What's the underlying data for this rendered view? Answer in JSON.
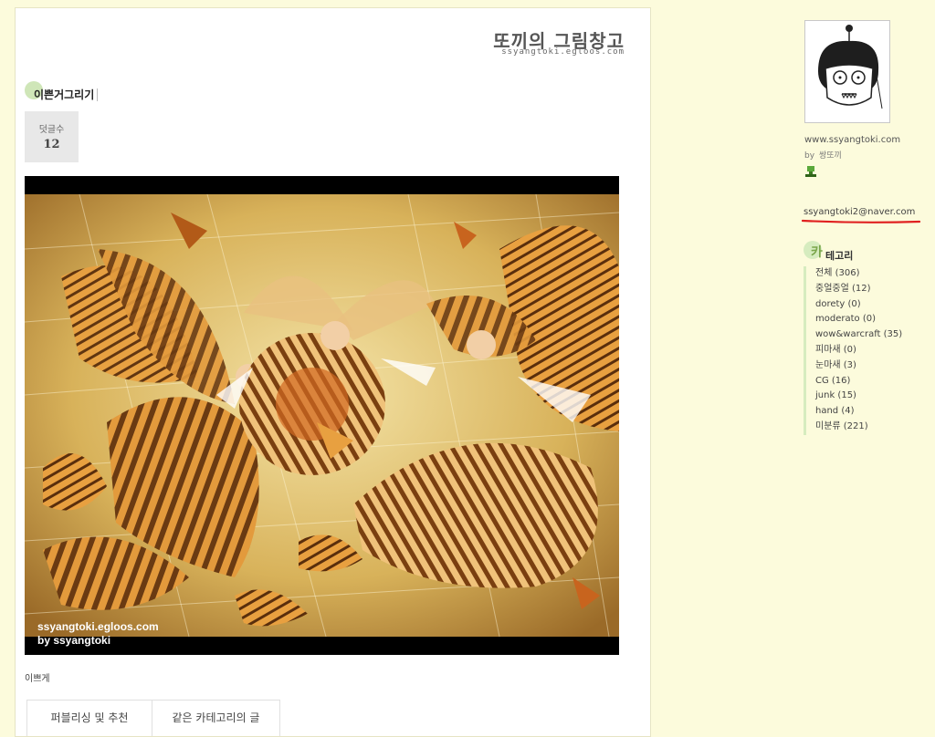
{
  "blog": {
    "title": "또끼의 그림창고",
    "url": "ssyangtoki.egloos.com"
  },
  "post": {
    "category": "이쁜거그리기",
    "comment_label": "덧글수",
    "comment_count": "12",
    "watermark_line1": "ssyangtoki.egloos.com",
    "watermark_line2": "by ssyangtoki",
    "caption": "이쁘게",
    "tabs": [
      "퍼블리싱 및 추천",
      "같은 카테고리의 글"
    ]
  },
  "sidebar": {
    "site_url": "www.ssyangtoki.com",
    "by_label": "by",
    "nickname": "쌍또끼",
    "email": "ssyangtoki2@naver.com",
    "category_first_char": "카",
    "category_rest": "테고리",
    "categories": [
      "전체 (306)",
      "중얼중얼 (12)",
      "dorety (0)",
      "moderato (0)",
      "wow&warcraft (35)",
      "피마새 (0)",
      "눈마새 (3)",
      "CG (16)",
      "junk (15)",
      "hand (4)",
      "미분류 (221)"
    ]
  },
  "colors": {
    "page_bg": "#fcfbdc",
    "accent_green": "#d6ecbf",
    "underline_red": "#e02020",
    "art_orange": "#c8641e",
    "art_gold": "#d8b25a"
  },
  "icons": [
    "badge-icon",
    "profile-avatar"
  ]
}
